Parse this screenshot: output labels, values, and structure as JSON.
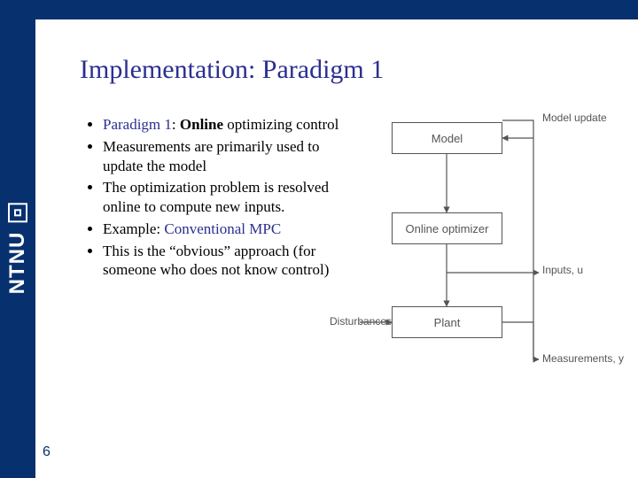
{
  "brand": {
    "name": "NTNU"
  },
  "slide": {
    "title": "Implementation: Paradigm 1",
    "page_number": "6"
  },
  "bullets": {
    "b1_pre": "Paradigm 1",
    "b1_mid": ": ",
    "b1_bold": "Online",
    "b1_post": " optimizing control",
    "b2": "Measurements are primarily used to update the model",
    "b3": "The optimization problem is resolved online to compute new inputs.",
    "b4_pre": "Example: ",
    "b4_hl": "Conventional MPC",
    "b5": "This is the “obvious” approach (for someone who does not know control)"
  },
  "diagram": {
    "box_model": "Model",
    "box_optimizer": "Online optimizer",
    "box_plant": "Plant",
    "label_model_update": "Model update",
    "label_inputs": "Inputs, u",
    "label_disturbances": "Disturbances",
    "label_measurements": "Measurements, y"
  }
}
